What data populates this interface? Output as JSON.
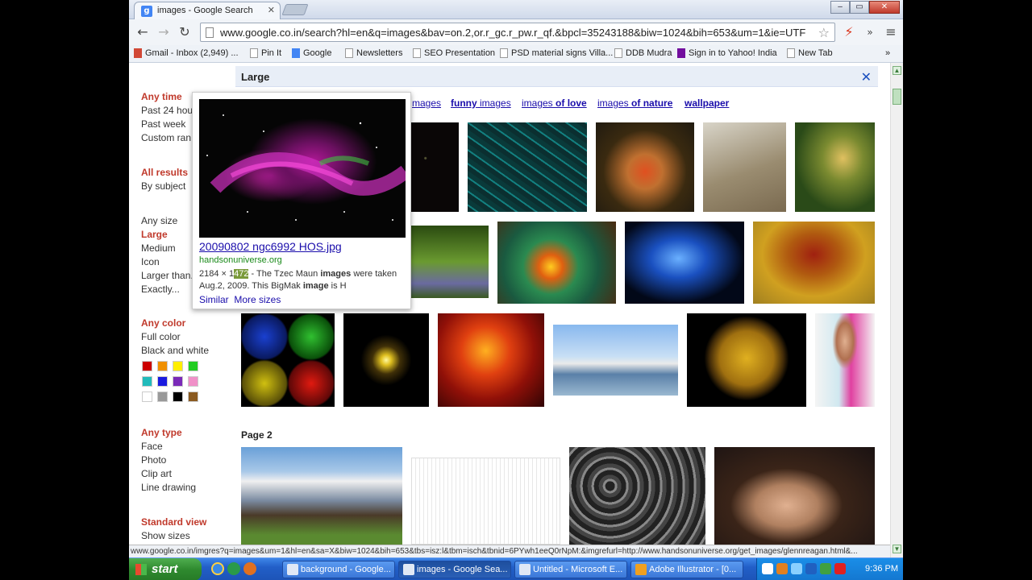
{
  "browser": {
    "tab_title": "images - Google Search",
    "tab_favicon": "g",
    "url": "www.google.co.in/search?hl=en&q=images&bav=on.2,or.r_gc.r_pw.r_qf.&bpcl=35243188&biw=1024&bih=653&um=1&ie=UTF",
    "window_buttons": [
      "–",
      "▭",
      "✕"
    ]
  },
  "bookmarks": [
    {
      "label": "Gmail - Inbox (2,949) ...",
      "icon": "m"
    },
    {
      "label": "Pin It",
      "icon": "page"
    },
    {
      "label": "Google",
      "icon": "g"
    },
    {
      "label": "Newsletters",
      "icon": "page"
    },
    {
      "label": "SEO Presentation",
      "icon": "page"
    },
    {
      "label": "PSD material signs Villa...",
      "icon": "page"
    },
    {
      "label": "DDB Mudra",
      "icon": "page"
    },
    {
      "label": "Sign in to Yahoo! India",
      "icon": "y"
    },
    {
      "label": "New Tab",
      "icon": "page"
    }
  ],
  "sidebar": {
    "time": {
      "head": "Any time",
      "items": [
        "Past 24 hou",
        "Past week",
        "Custom ran"
      ]
    },
    "results": {
      "head": "All results",
      "items": [
        "By subject"
      ]
    },
    "size": {
      "items": [
        "Any size"
      ],
      "selected": "Large",
      "rest": [
        "Medium",
        "Icon",
        "Larger than...",
        "Exactly..."
      ]
    },
    "color": {
      "head": "Any color",
      "items": [
        "Full color",
        "Black and white"
      ],
      "swatches": [
        "#cc0000",
        "#f09000",
        "#ffee00",
        "#22cc22",
        "#22bbbb",
        "#1a1adf",
        "#7a2ab8",
        "#f090c8",
        "#ffffff",
        "#999999",
        "#000000",
        "#8a5a20"
      ]
    },
    "type": {
      "head": "Any type",
      "items": [
        "Face",
        "Photo",
        "Clip art",
        "Line drawing"
      ]
    },
    "view": {
      "head": "Standard view",
      "items": [
        "Show sizes"
      ]
    }
  },
  "filter_bar": {
    "label": "Large",
    "close": "✕"
  },
  "related": [
    {
      "plain": "",
      "bold": "",
      "text": "mages"
    },
    {
      "plain": "",
      "bold": "funny",
      "text": " images"
    },
    {
      "plain": "images ",
      "bold": "of love",
      "text": ""
    },
    {
      "plain": "images ",
      "bold": "of nature",
      "text": ""
    },
    {
      "plain": "",
      "bold": "wallpaper",
      "text": ""
    }
  ],
  "page2_label": "Page 2",
  "popup": {
    "title": "20090802 ngc6992 HOS.jpg",
    "domain": "handsonuniverse.org",
    "desc_pre": "2184 × 1",
    "desc_hl": "472",
    "desc_post": " - The Tzec Maun ",
    "desc_b1": "images",
    "desc_mid": " were taken Aug.2, 2009. This BigMak ",
    "desc_b2": "image",
    "desc_end": " is H",
    "link_similar": "Similar",
    "link_more": "More sizes"
  },
  "statusbar": "www.google.co.in/imgres?q=images&um=1&hl=en&sa=X&biw=1024&bih=653&tbs=isz:l&tbm=isch&tbnid=6PYwh1eeQ0rNpM:&imgrefurl=http://www.handsonuniverse.org/get_images/glennreagan.html&...",
  "taskbar": {
    "start": "start",
    "items": [
      "background - Google...",
      "images - Google Sea...",
      "Untitled - Microsoft E...",
      "Adobe Illustrator - [0..."
    ],
    "clock": "9:36 PM"
  }
}
